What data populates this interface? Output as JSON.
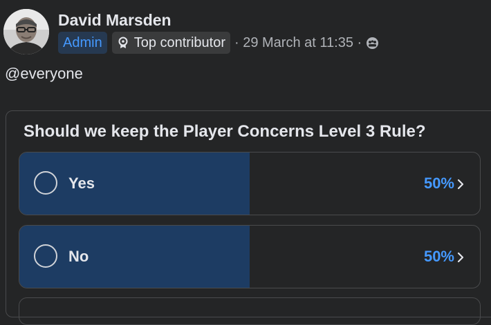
{
  "post": {
    "author": "David Marsden",
    "badges": {
      "admin": "Admin",
      "top_contributor": "Top contributor"
    },
    "meta": "· 29 March at 11:35 ·",
    "mention": "@everyone"
  },
  "poll": {
    "question": "Should we keep the Player Concerns Level 3 Rule?",
    "options": [
      {
        "label": "Yes",
        "percent_text": "50%",
        "fraction": 0.5
      },
      {
        "label": "No",
        "percent_text": "50%",
        "fraction": 0.5
      }
    ]
  },
  "colors": {
    "background": "#242526",
    "accent_blue": "#4599ff",
    "fill_blue": "#1d3c63",
    "admin_badge_bg": "#263951"
  },
  "icons": {
    "top_contributor": "award-icon",
    "audience": "group-audience-icon",
    "option_arrow": "chevron-right-icon"
  }
}
